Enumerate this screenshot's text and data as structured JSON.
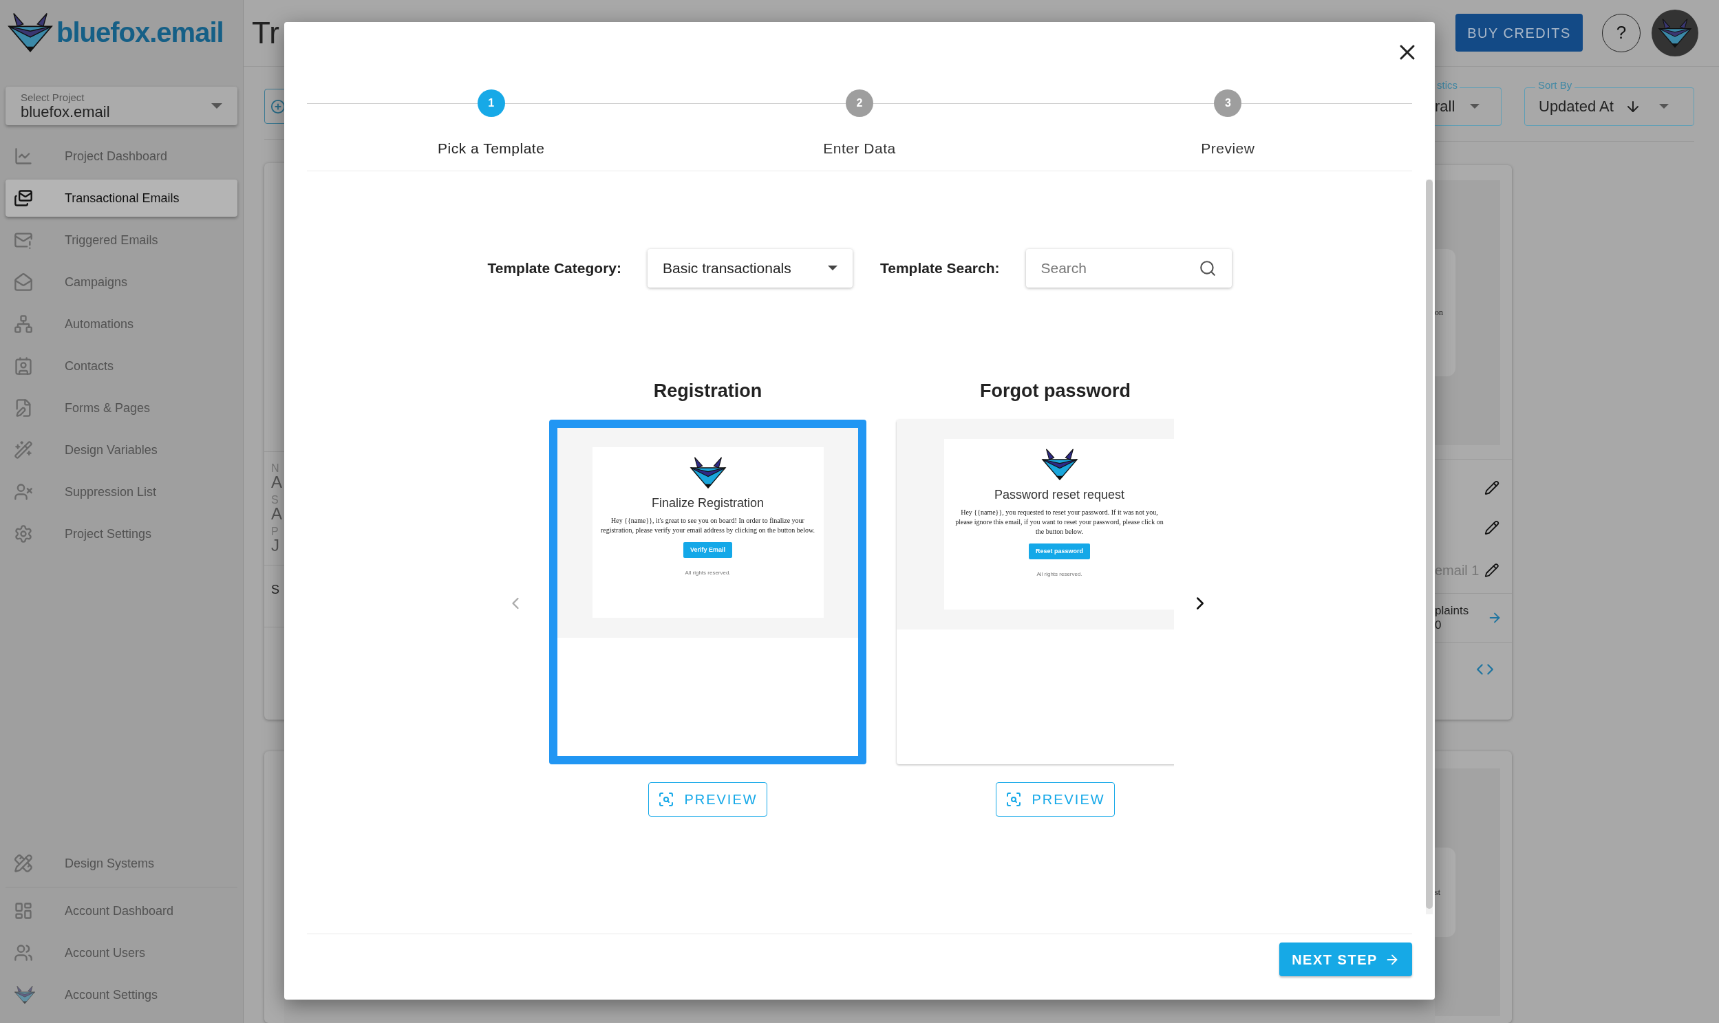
{
  "sidebar": {
    "logo_text": "bluefox.email",
    "project_select": {
      "label": "Select Project",
      "value": "bluefox.email"
    },
    "items": [
      {
        "label": "Project Dashboard",
        "selected": false
      },
      {
        "label": "Transactional Emails",
        "selected": true
      },
      {
        "label": "Triggered Emails",
        "selected": false
      },
      {
        "label": "Campaigns",
        "selected": false
      },
      {
        "label": "Automations",
        "selected": false
      },
      {
        "label": "Contacts",
        "selected": false
      },
      {
        "label": "Forms & Pages",
        "selected": false
      },
      {
        "label": "Design Variables",
        "selected": false
      },
      {
        "label": "Suppression List",
        "selected": false
      },
      {
        "label": "Project Settings",
        "selected": false
      }
    ],
    "bottom_items": [
      {
        "label": "Design Systems",
        "selected": false
      },
      {
        "label": "Account Dashboard",
        "selected": false
      },
      {
        "label": "Account Users",
        "selected": false
      },
      {
        "label": "Account Settings",
        "selected": false
      }
    ]
  },
  "header": {
    "title_fragment": "Tr",
    "buy_credits": "BUY CREDITS",
    "help": "?"
  },
  "filters": {
    "statistics_label_fragment": "stics",
    "statistics_value_fragment": "rall",
    "sort_label": "Sort By",
    "sort_value": "Updated At"
  },
  "left_card_fragment": {
    "fields": [
      {
        "label": "N",
        "value": "A"
      },
      {
        "label": "S",
        "value": "A"
      },
      {
        "label": "P",
        "value": "J"
      }
    ],
    "section": "S"
  },
  "right_card_fragment": {
    "preview_text": "on",
    "field_text": "email 1",
    "stat_label": "plaints",
    "stat_value": "0"
  },
  "right_card_2_fragment": {
    "preview_text": "st"
  },
  "dialog": {
    "steps": [
      {
        "number": "1",
        "label": "Pick a Template",
        "selected": true
      },
      {
        "number": "2",
        "label": "Enter Data",
        "selected": false
      },
      {
        "number": "3",
        "label": "Preview",
        "selected": false
      }
    ],
    "category": {
      "label": "Template Category:",
      "value": "Basic transactionals"
    },
    "search": {
      "label": "Template Search:",
      "placeholder": "Search"
    },
    "templates": [
      {
        "title": "Registration",
        "selected": true,
        "email": {
          "heading": "Finalize Registration",
          "body": "Hey {{name}}, it's great to see you on board! In order to finalize your registration, please verify your email address by clicking on the button below.",
          "button": "Verify Email",
          "footer": "All rights reserved."
        },
        "preview": "PREVIEW"
      },
      {
        "title": "Forgot password",
        "selected": false,
        "email": {
          "heading": "Password reset request",
          "body": "Hey {{name}}, you requested to reset your password. If it was not you, please ignore this email, if you want to reset your password, please click on the button below.",
          "button": "Reset password",
          "footer": "All rights reserved."
        },
        "preview": "PREVIEW"
      }
    ],
    "next_button": "NEXT STEP"
  }
}
